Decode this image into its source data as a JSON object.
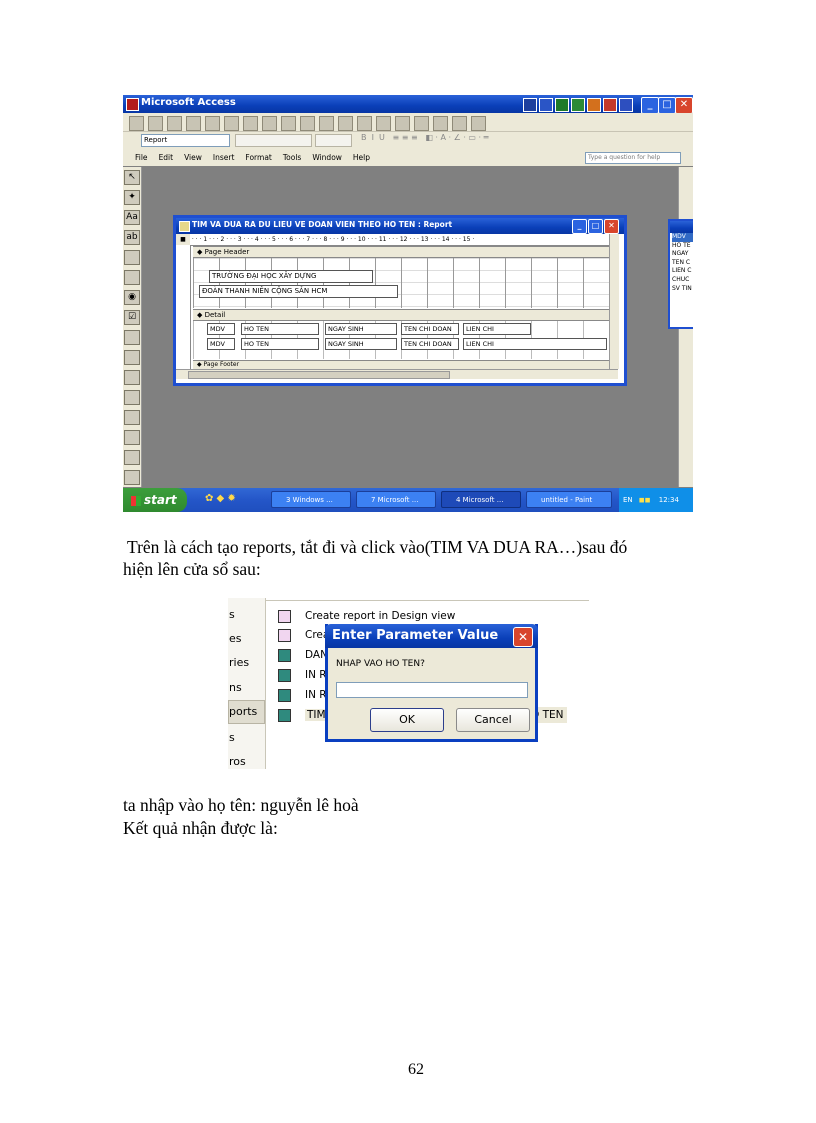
{
  "access_window": {
    "title": "Microsoft Access",
    "style_combo": "Report",
    "help_box": "Type a question for help",
    "menu": [
      "File",
      "Edit",
      "View",
      "Insert",
      "Format",
      "Tools",
      "Window",
      "Help"
    ]
  },
  "report_window": {
    "title": "TIM VA DUA RA DU LIEU VE DOAN VIEN THEO HO TEN : Report",
    "ruler": "· · · 1 · · · 2 · · · 3 · · · 4 · · · 5 · · · 6 · · · 7 · · · 8 · · · 9 · · · 10 · · · 11 · · · 12 · · · 13 · · · 14 · · · 15 ·",
    "page_header_band": "Page Header",
    "header_label_1": "TRƯỜNG ĐẠI HỌC XÂY DỰNG",
    "header_label_2": "ĐOÀN THANH NIÊN CỘNG SẢN HCM",
    "detail_band": "Detail",
    "detail_row_1": [
      "MDV",
      "HO TEN",
      "NGAY SINH",
      "TEN CHI DOAN",
      "LIEN CHI"
    ],
    "detail_row_2": [
      "MDV",
      "HO TEN",
      "NGAY SINH",
      "TEN CHI DOAN",
      "LIEN CHI"
    ],
    "page_footer_band": "Page Footer"
  },
  "field_list": {
    "fields": [
      "MDV",
      "HO TE",
      "NGAY",
      "TEN C",
      "LIEN C",
      "CHUC",
      "SV TIN"
    ]
  },
  "taskbar": {
    "start": "start",
    "tasks": [
      "3 Windows ...",
      "7 Microsoft ...",
      "4 Microsoft ...",
      "untitled - Paint"
    ],
    "lang": "EN",
    "clock": "12:34"
  },
  "paragraph_1_line_1": "Trên là cách tạo reports, tắt đi và click vào(TIM VA DUA RA…)sau đó",
  "paragraph_1_line_2": "hiện lên cửa sổ sau:",
  "db_window": {
    "sidebar": [
      "s",
      "es",
      "ries",
      "ns",
      "ports",
      "s",
      "ros"
    ],
    "items": [
      "Create report in Design view",
      "Crea",
      "DAN",
      "IN R",
      "IN R",
      "TIM"
    ],
    "trailing_text": "O TEN"
  },
  "dialog": {
    "title": "Enter Parameter Value",
    "prompt": "NHAP VAO HO TEN?",
    "ok": "OK",
    "cancel": "Cancel"
  },
  "paragraph_2_line_1": "ta nhập vào họ tên: nguyễn lê  hoà",
  "paragraph_2_line_2": "Kết quả nhận được là:",
  "page_number": "62"
}
